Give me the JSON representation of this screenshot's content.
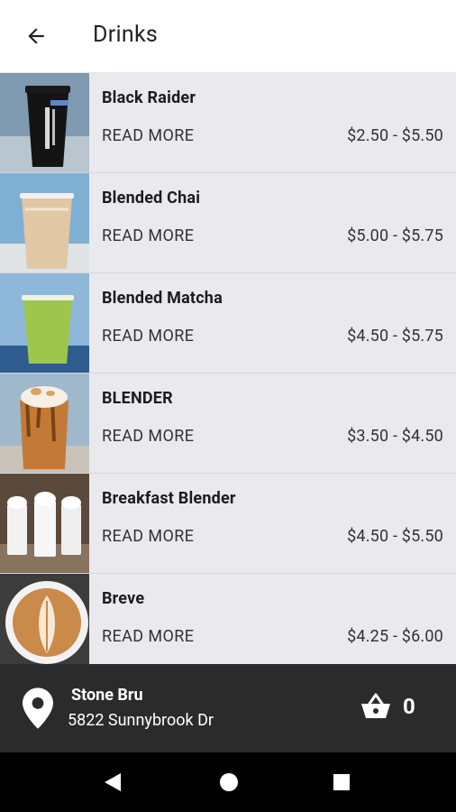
{
  "header": {
    "title": "Drinks",
    "back_icon": "arrow-left-icon"
  },
  "products": [
    {
      "name": "Black Raider",
      "read_more": "READ MORE",
      "price": "$2.50 - $5.50"
    },
    {
      "name": "Blended Chai",
      "read_more": "READ MORE",
      "price": "$5.00 - $5.75"
    },
    {
      "name": "Blended Matcha",
      "read_more": "READ MORE",
      "price": "$4.50 - $5.75"
    },
    {
      "name": "BLENDER",
      "read_more": "READ MORE",
      "price": "$3.50 - $4.50"
    },
    {
      "name": "Breakfast Blender",
      "read_more": "READ MORE",
      "price": "$4.50 - $5.50"
    },
    {
      "name": "Breve",
      "read_more": "READ MORE",
      "price": "$4.25 - $6.00"
    }
  ],
  "footer": {
    "store_name": "Stone Bru",
    "address": "5822 Sunnybrook Dr",
    "cart_count": "0",
    "location_icon": "map-pin-icon",
    "cart_icon": "basket-icon"
  },
  "colors": {
    "list_bg": "#e9e9ee",
    "footer_bg": "#2b2b2b",
    "nav_bg": "#000000"
  }
}
